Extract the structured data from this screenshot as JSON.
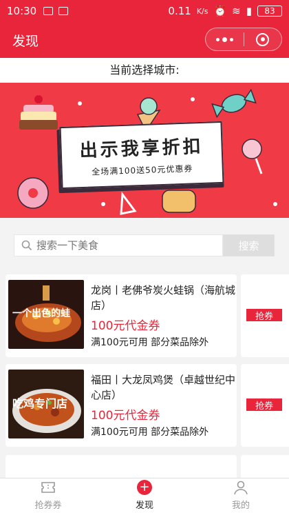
{
  "status": {
    "time": "10:30",
    "speed": "0.11",
    "speed_unit": "K/s",
    "battery": "83"
  },
  "navbar": {
    "title": "发现"
  },
  "city": {
    "label": "当前选择城市:"
  },
  "banner": {
    "title": "出示我享折扣",
    "subtitle": "全场满100送50元优惠券"
  },
  "search": {
    "placeholder": "搜索一下美食",
    "button": "搜索"
  },
  "coupons": [
    {
      "name": "龙岗丨老佛爷炭火蛙锅（海航城店）",
      "price": "100元代金券",
      "condition": "满100元可用 部分菜品除外",
      "action": "抢券",
      "image_text": "一个出色的蛙"
    },
    {
      "name": "福田丨大龙凤鸡煲（卓越世纪中心店）",
      "price": "100元代金券",
      "condition": "满100元可用 部分菜品除外",
      "action": "抢券",
      "image_text": "吃鸡专门店"
    }
  ],
  "tabbar": {
    "items": [
      {
        "label": "抢券券"
      },
      {
        "label": "发现"
      },
      {
        "label": "我的"
      }
    ],
    "active": "发现"
  },
  "colors": {
    "brand": "#e8253b",
    "banner_bg": "#f03a45"
  }
}
